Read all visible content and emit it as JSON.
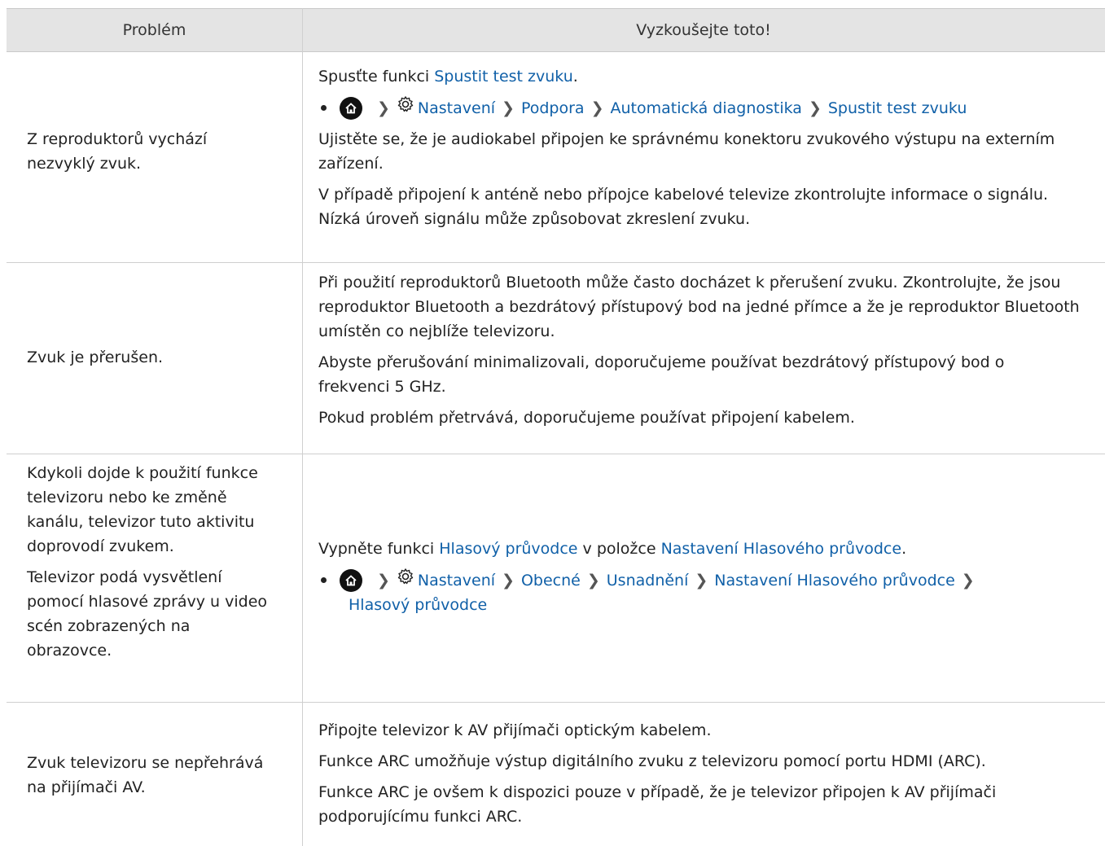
{
  "header": {
    "col1": "Problém",
    "col2": "Vyzkoušejte toto!"
  },
  "rows": [
    {
      "problem": "Z reproduktorů vychází nezvyklý zvuk.",
      "p1_pre": "Spusťte funkci ",
      "p1_link": "Spustit test zvuku",
      "p1_post": ".",
      "path": [
        "Nastavení",
        "Podpora",
        "Automatická diagnostika",
        "Spustit test zvuku"
      ],
      "p2": "Ujistěte se, že je audiokabel připojen ke správnému konektoru zvukového výstupu na externím zařízení.",
      "p3": "V případě připojení k anténě nebo přípojce kabelové televize zkontrolujte informace o signálu. Nízká úroveň signálu může způsobovat zkreslení zvuku."
    },
    {
      "problem": "Zvuk je přerušen.",
      "p1": "Při použití reproduktorů Bluetooth může často docházet k přerušení zvuku. Zkontrolujte, že jsou reproduktor Bluetooth a bezdrátový přístupový bod na jedné přímce a že je reproduktor Bluetooth umístěn co nejblíže televizoru.",
      "p2": "Abyste přerušování minimalizovali, doporučujeme používat bezdrátový přístupový bod o frekvenci 5 GHz.",
      "p3": "Pokud problém přetrvává, doporučujeme používat připojení kabelem."
    },
    {
      "problem1": "Kdykoli dojde k použití funkce televizoru nebo ke změně kanálu, televizor tuto aktivitu doprovodí zvukem.",
      "problem2": "Televizor podá vysvětlení pomocí hlasové zprávy u video scén zobrazených na obrazovce.",
      "p1_pre": "Vypněte funkci ",
      "p1_link1": "Hlasový průvodce",
      "p1_mid": " v položce ",
      "p1_link2": "Nastavení Hlasového průvodce",
      "p1_post": ".",
      "path": [
        "Nastavení",
        "Obecné",
        "Usnadnění",
        "Nastavení Hlasového průvodce",
        "Hlasový průvodce"
      ]
    },
    {
      "problem": "Zvuk televizoru se nepřehrává na přijímači AV.",
      "p1": "Připojte televizor k AV přijímači optickým kabelem.",
      "p2": "Funkce ARC umožňuje výstup digitálního zvuku z televizoru pomocí portu HDMI (ARC).",
      "p3": "Funkce ARC je ovšem k dispozici pouze v případě, že je televizor připojen k AV přijímači podporujícímu funkci ARC."
    }
  ],
  "colors": {
    "link": "#1060a8",
    "header_bg": "#e4e4e4",
    "grid": "#cfcfcf"
  }
}
